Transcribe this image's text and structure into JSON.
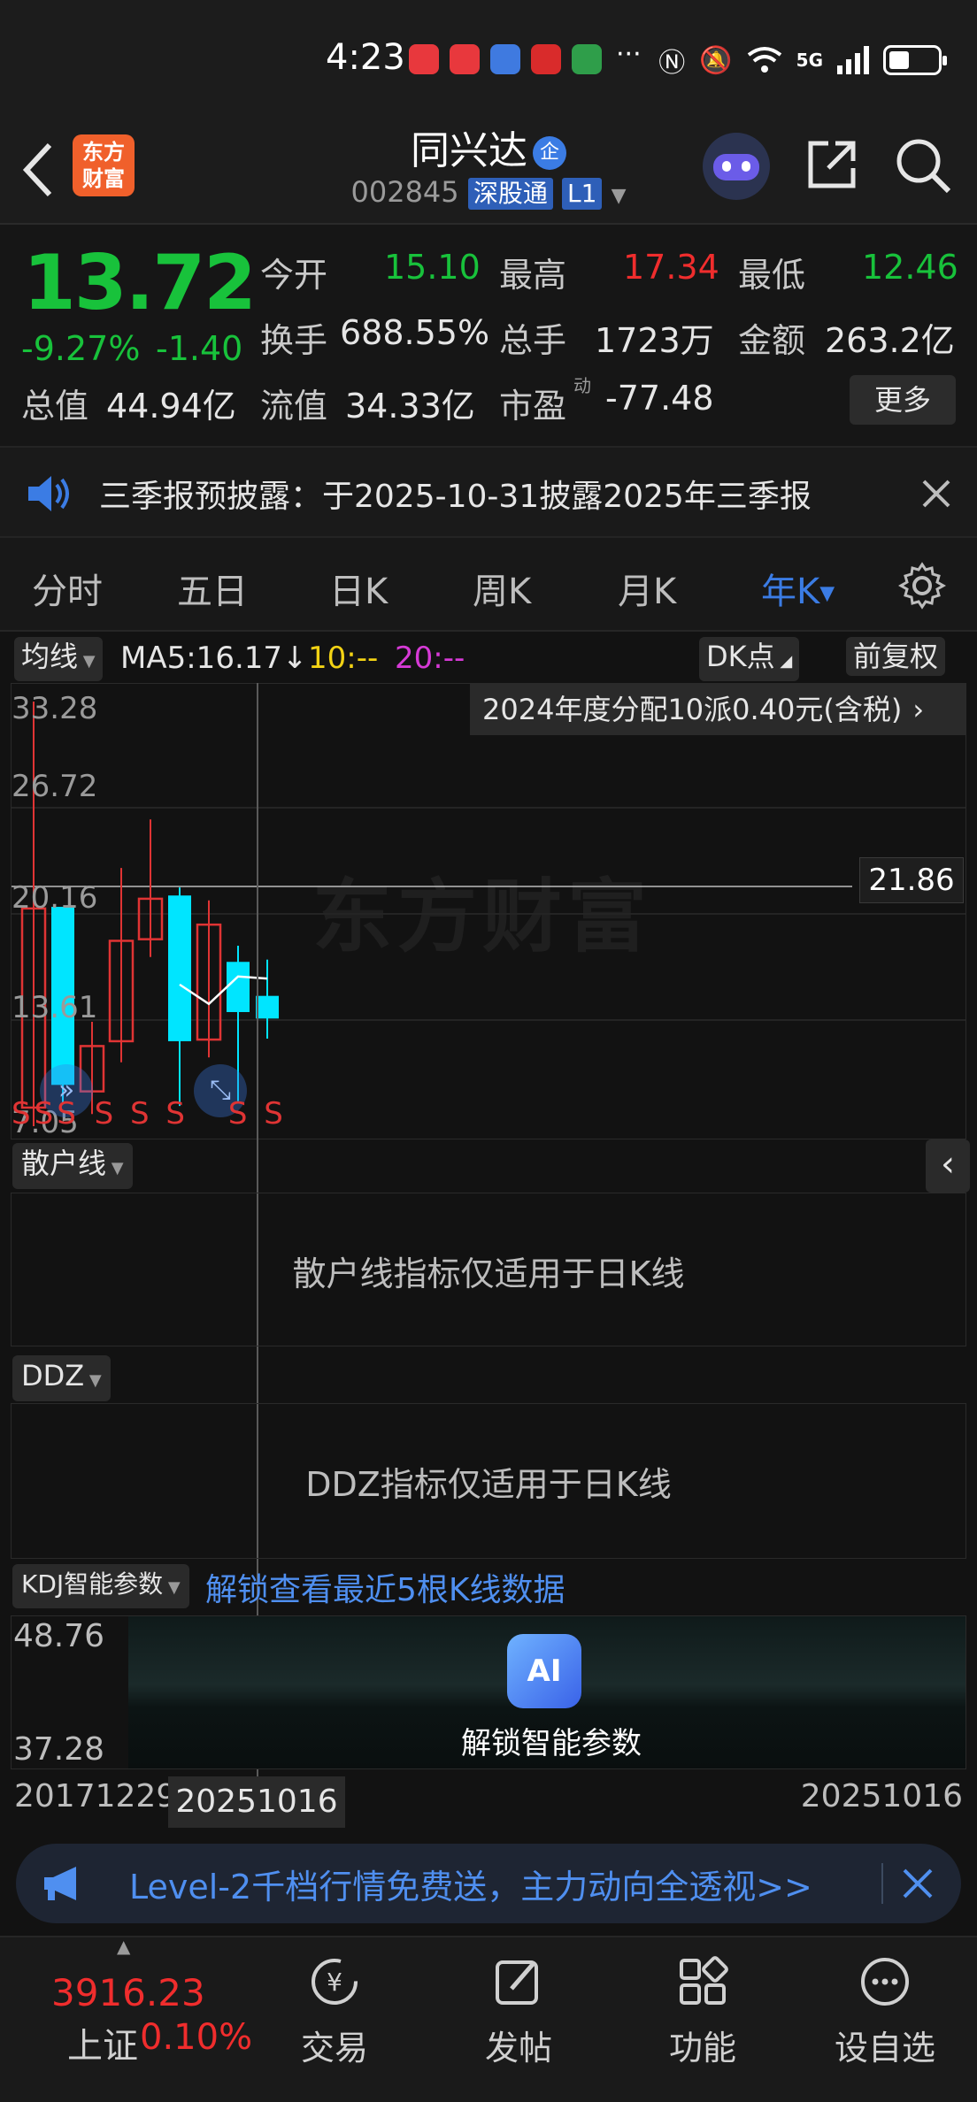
{
  "status_bar": {
    "time": "4:23",
    "more": "···",
    "signal": "5G",
    "app_colors": [
      "#e8383d",
      "#e8383d",
      "#3f7ae0",
      "#d92b2b",
      "#2f9e4a"
    ]
  },
  "header": {
    "logo_line1": "东方",
    "logo_line2": "财富",
    "stock_name": "同兴达",
    "badge": "企",
    "code": "002845",
    "tag_connect": "深股通",
    "tag_level": "L1"
  },
  "quote": {
    "price": "13.72",
    "change_pct": "-9.27%",
    "change": "-1.40",
    "open_label": "今开",
    "open": "15.10",
    "high_label": "最高",
    "high": "17.34",
    "low_label": "最低",
    "low": "12.46",
    "turnover_label": "换手",
    "turnover": "688.55%",
    "volume_label": "总手",
    "volume": "1723万",
    "amount_label": "金额",
    "amount": "263.2亿",
    "mktcap_label": "总值",
    "mktcap": "44.94亿",
    "float_label": "流值",
    "float": "34.33亿",
    "pe_label": "市盈",
    "pe_sup": "动",
    "pe": "-77.48",
    "more": "更多"
  },
  "notice": {
    "text": "三季报预披露：于2025-10-31披露2025年三季报"
  },
  "tabs": [
    {
      "label": "分时"
    },
    {
      "label": "五日"
    },
    {
      "label": "日K"
    },
    {
      "label": "周K"
    },
    {
      "label": "月K"
    },
    {
      "label": "年K"
    }
  ],
  "ma_bar": {
    "indicator": "均线",
    "ma5": "MA5:16.17",
    "ma10": "10:--",
    "ma20": "20:--",
    "dk": "DK点",
    "adjust": "前复权"
  },
  "kchart": {
    "dividend_banner": "2024年度分配10派0.40元(含税)",
    "price_tag": "21.86",
    "watermark": "东方财富",
    "y_labels": [
      "33.28",
      "26.72",
      "20.16",
      "13.61",
      "7.05"
    ],
    "signal_letters": [
      "S",
      "S",
      "S",
      "S",
      "S",
      "S",
      "S",
      "S"
    ]
  },
  "chart_data": {
    "type": "candlestick",
    "ylim": [
      7.05,
      33.28
    ],
    "ma5_current": 16.17,
    "candles": [
      {
        "open": 8.2,
        "close": 20.5,
        "high": 33.28,
        "low": 7.05,
        "color": "red"
      },
      {
        "open": 20.6,
        "close": 9.6,
        "high": 20.6,
        "low": 8.4,
        "color": "cyan"
      },
      {
        "open": 9.2,
        "close": 12.0,
        "high": 13.5,
        "low": 7.8,
        "color": "red"
      },
      {
        "open": 12.3,
        "close": 18.5,
        "high": 23.0,
        "low": 11.0,
        "color": "red"
      },
      {
        "open": 18.6,
        "close": 21.1,
        "high": 26.0,
        "low": 17.5,
        "color": "red"
      },
      {
        "open": 21.3,
        "close": 12.3,
        "high": 21.8,
        "low": 8.3,
        "color": "cyan"
      },
      {
        "open": 12.4,
        "close": 19.5,
        "high": 21.0,
        "low": 11.3,
        "color": "red"
      },
      {
        "open": 17.2,
        "close": 14.1,
        "high": 18.2,
        "low": 8.6,
        "color": "cyan"
      },
      {
        "open": 15.1,
        "close": 13.7,
        "high": 17.34,
        "low": 12.46,
        "color": "cyan"
      }
    ],
    "ma5": [
      null,
      null,
      null,
      null,
      null,
      15.8,
      14.6,
      16.3,
      16.17
    ]
  },
  "sanhu": {
    "title": "散户线",
    "msg": "散户线指标仅适用于日K线"
  },
  "ddz": {
    "title": "DDZ",
    "msg": "DDZ指标仅适用于日K线"
  },
  "kdj": {
    "title": "KDJ智能参数",
    "unlock_link": "解锁查看最近5根K线数据",
    "y_top": "48.76",
    "y_bottom": "37.28",
    "ai_icon": "AI",
    "ai_label": "解锁智能参数"
  },
  "dates": {
    "start": "20171229",
    "cursor": "20251016",
    "end": "20251016"
  },
  "promo": {
    "text": "Level-2千档行情免费送，主力动向全透视>>"
  },
  "bottom_nav": {
    "index_value": "3916.23",
    "index_name": "上证",
    "index_change": "0.10%",
    "trade": "交易",
    "post": "发帖",
    "func": "功能",
    "watch": "设自选"
  },
  "colors": {
    "up": "#f02d2d",
    "down": "#18c23b",
    "candle_down": "#00e5ff",
    "accent": "#3b7ce4"
  }
}
